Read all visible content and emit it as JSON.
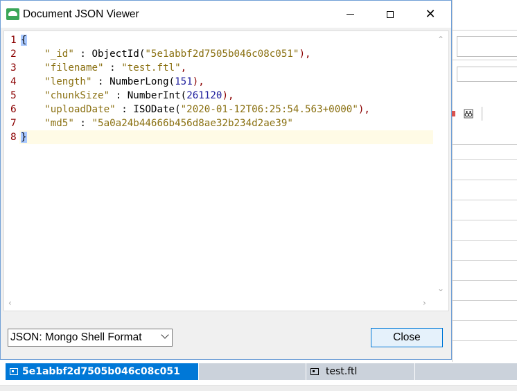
{
  "window": {
    "title": "Document JSON Viewer",
    "icon": "app-leaf-icon",
    "controls": [
      "minimize-icon",
      "maximize-icon",
      "close-icon"
    ]
  },
  "editor": {
    "line_numbers": [
      "1",
      "2",
      "3",
      "4",
      "5",
      "6",
      "7",
      "8"
    ],
    "lines": [
      {
        "text": "{"
      },
      {
        "key": "\"_id\"",
        "sep": " : ",
        "fn": "ObjectId(",
        "str": "\"5e1abbf2d7505b046c08c051\"",
        "tail": "),"
      },
      {
        "key": "\"filename\"",
        "sep": " : ",
        "str": "\"test.ftl\"",
        "tail": ","
      },
      {
        "key": "\"length\"",
        "sep": " : ",
        "fn": "NumberLong(",
        "num": "151",
        "tail": "),"
      },
      {
        "key": "\"chunkSize\"",
        "sep": " : ",
        "fn": "NumberInt(",
        "num": "261120",
        "tail": "),"
      },
      {
        "key": "\"uploadDate\"",
        "sep": " : ",
        "fn": "ISODate(",
        "str": "\"2020-01-12T06:25:54.563+0000\"",
        "tail": "),"
      },
      {
        "key": "\"md5\"",
        "sep": " : ",
        "str": "\"5a0a24b44666b456d8ae32b234d2ae39\""
      },
      {
        "text": "}"
      }
    ]
  },
  "footer": {
    "format_select": {
      "selected": "JSON: Mongo Shell Format"
    },
    "close_label": "Close"
  },
  "background": {
    "row": {
      "id_cell": "5e1abbf2d7505b046c08c051",
      "filename_cell": "test.ftl"
    }
  },
  "colors": {
    "accent": "#0078d7",
    "title_bar_border": "#6f9fd6",
    "line_number": "#8b0000",
    "json_string": "#8a7011",
    "json_number": "#1c1c9c",
    "current_line": "#fffbe6"
  }
}
